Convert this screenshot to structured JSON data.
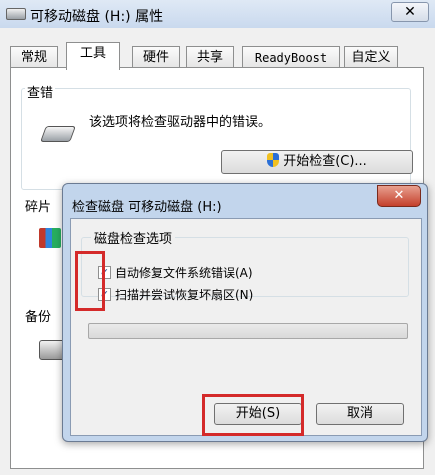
{
  "outer_window": {
    "title": "可移动磁盘 (H:) 属性",
    "close_glyph": "✕",
    "tabs": [
      {
        "label": "常规"
      },
      {
        "label": "工具"
      },
      {
        "label": "硬件"
      },
      {
        "label": "共享"
      },
      {
        "label": "ReadyBoost"
      },
      {
        "label": "自定义"
      }
    ],
    "error_check": {
      "heading": "查错",
      "description": "该选项将检查驱动器中的错误。",
      "button_label": "开始检查(C)..."
    },
    "defrag_heading": "碎片",
    "backup_heading": "备份"
  },
  "check_dialog": {
    "title": "检查磁盘 可移动磁盘 (H:)",
    "close_glyph": "✕",
    "options_legend": "磁盘检查选项",
    "options": [
      {
        "label": "自动修复文件系统错误(A)",
        "checked": true
      },
      {
        "label": "扫描并尝试恢复坏扇区(N)",
        "checked": true
      }
    ],
    "progress": 0,
    "start_button": "开始(S)",
    "cancel_button": "取消"
  },
  "highlight_color": "#d42a2a"
}
